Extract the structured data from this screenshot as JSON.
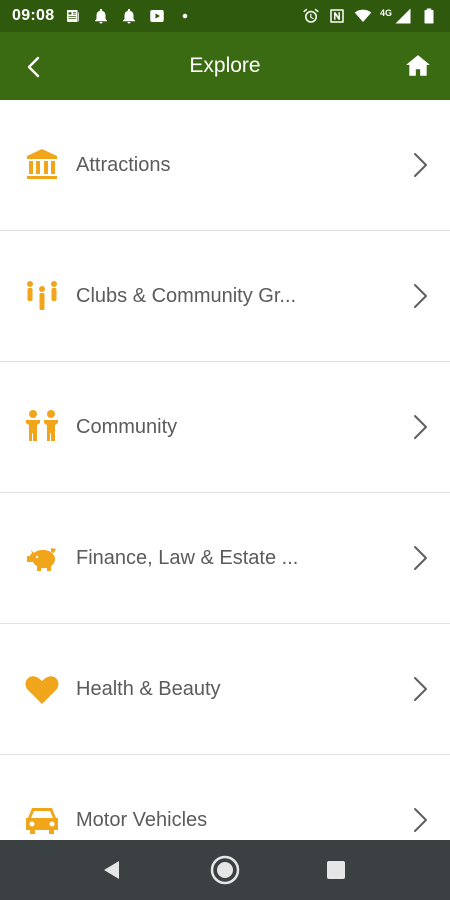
{
  "status_bar": {
    "time": "09:08",
    "network_label": "4G",
    "left_icons": [
      "news-icon",
      "notification-bell-icon",
      "notification-bell-icon",
      "youtube-icon",
      "dot-icon"
    ],
    "right_icons": [
      "alarm-icon",
      "nfc-icon",
      "wifi-icon",
      "cell-signal-icon",
      "battery-icon"
    ]
  },
  "app_bar": {
    "title": "Explore",
    "back_icon": "chevron-left-icon",
    "home_icon": "home-icon"
  },
  "list": {
    "items": [
      {
        "label": "Attractions",
        "icon": "museum-icon"
      },
      {
        "label": "Clubs & Community Gr...",
        "icon": "people-icon"
      },
      {
        "label": "Community",
        "icon": "family-icon"
      },
      {
        "label": "Finance, Law & Estate ...",
        "icon": "piggy-bank-icon"
      },
      {
        "label": "Health & Beauty",
        "icon": "heart-icon"
      },
      {
        "label": "Motor Vehicles",
        "icon": "car-icon"
      }
    ]
  },
  "colors": {
    "status_bar_bg": "#2f5a0d",
    "app_bar_bg": "#3a6a11",
    "accent_icon": "#f0a51a",
    "label_text": "#5b5b5b",
    "nav_bar_bg": "#3b4042"
  },
  "nav_bar": {
    "icons": [
      "nav-back-icon",
      "nav-home-icon",
      "nav-recents-icon"
    ]
  }
}
